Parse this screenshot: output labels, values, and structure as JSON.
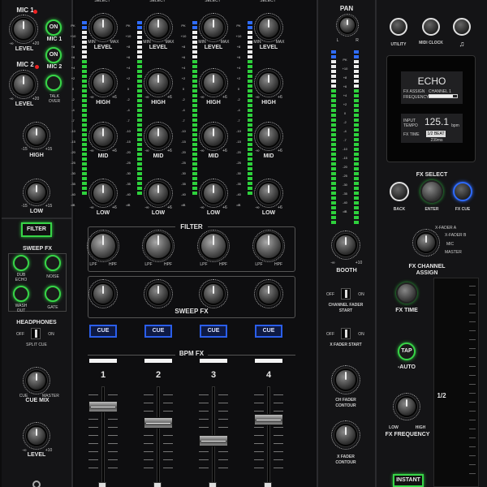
{
  "mic1": {
    "title": "MIC 1",
    "level": "LEVEL",
    "min": "-∞",
    "max": "+20",
    "on": "ON",
    "btn": "MIC 1"
  },
  "mic2": {
    "title": "MIC 2",
    "level": "LEVEL",
    "min": "-∞",
    "max": "+20",
    "on": "ON",
    "btn": "MIC 2",
    "talk": "TALK OVER"
  },
  "mic_eq": {
    "high": "HIGH",
    "low": "LOW",
    "min": "-15",
    "max": "+15"
  },
  "filter_button": "FILTER",
  "sweep": {
    "title": "SWEEP FX",
    "dub": "DUB ECHO",
    "noise": "NOISE",
    "wash": "WASH OUT",
    "gate": "GATE"
  },
  "headphones": {
    "title": "HEADPHONES",
    "off": "OFF",
    "on": "ON",
    "split": "SPLIT CUE",
    "cuemix": "CUE MIX",
    "cue": "CUE",
    "master": "MASTER",
    "level": "LEVEL",
    "min": "-∞",
    "max": "+10"
  },
  "channels": {
    "top_label": "SELECT",
    "level": "LEVEL",
    "high": "HIGH",
    "mid": "MID",
    "low": "LOW",
    "min": "MIN",
    "max": "MAX",
    "eqmin": "-∞",
    "eqmax": "+6",
    "cue": "CUE",
    "numbers": [
      "1",
      "2",
      "3",
      "4"
    ],
    "meter_scale": [
      "PK",
      "+10",
      "+8",
      "+6",
      "+4",
      "+2",
      "0",
      "-2",
      "-4",
      "-7",
      "-10",
      "-15",
      "-20",
      "-25",
      "-30",
      "-35",
      "-40",
      "dB"
    ]
  },
  "filter_section": {
    "title": "FILTER",
    "lpf": "LPF",
    "hpf": "HPF"
  },
  "sweep_section": {
    "title": "SWEEP FX"
  },
  "bpm_fx": {
    "title": "BPM FX"
  },
  "master": {
    "pan": "PAN",
    "l": "L",
    "r": "R",
    "booth": "BOOTH",
    "min": "-∞",
    "max": "+10",
    "fader_start": "CHANNEL FADER START",
    "x_start": "X FADER START",
    "off": "OFF",
    "on": "ON",
    "ch_contour": "CH FADER CONTOUR",
    "x_contour": "X FADER CONTOUR"
  },
  "right": {
    "utility": "UTILITY",
    "midi": "MIDI CLOCK",
    "display": {
      "effect": "ECHO",
      "assign_label": "FX ASSIGN",
      "assign_value": "CHANNEL 1",
      "freq_label": "FREQUENCY",
      "input_label": "INPUT TEMPO",
      "tempo": "125.1",
      "tempo_unit": "bpm",
      "fxtime_label": "FX TIME",
      "beat": "1/2 BEAT",
      "ms": "239ms"
    },
    "fx_select": "FX SELECT",
    "back": "BACK",
    "enter": "ENTER",
    "fx_cue": "FX CUE",
    "assign_opts": [
      "X-FADER A",
      "X-FADER B",
      "MIC",
      "MASTER"
    ],
    "channel_assign": "FX CHANNEL ASSIGN",
    "fx_time": "FX TIME",
    "tap": "TAP",
    "auto": "-AUTO",
    "low": "LOW",
    "high": "HIGH",
    "fx_freq": "FX FREQUENCY",
    "instant": "INSTANT",
    "beat_pad": "1/2"
  }
}
